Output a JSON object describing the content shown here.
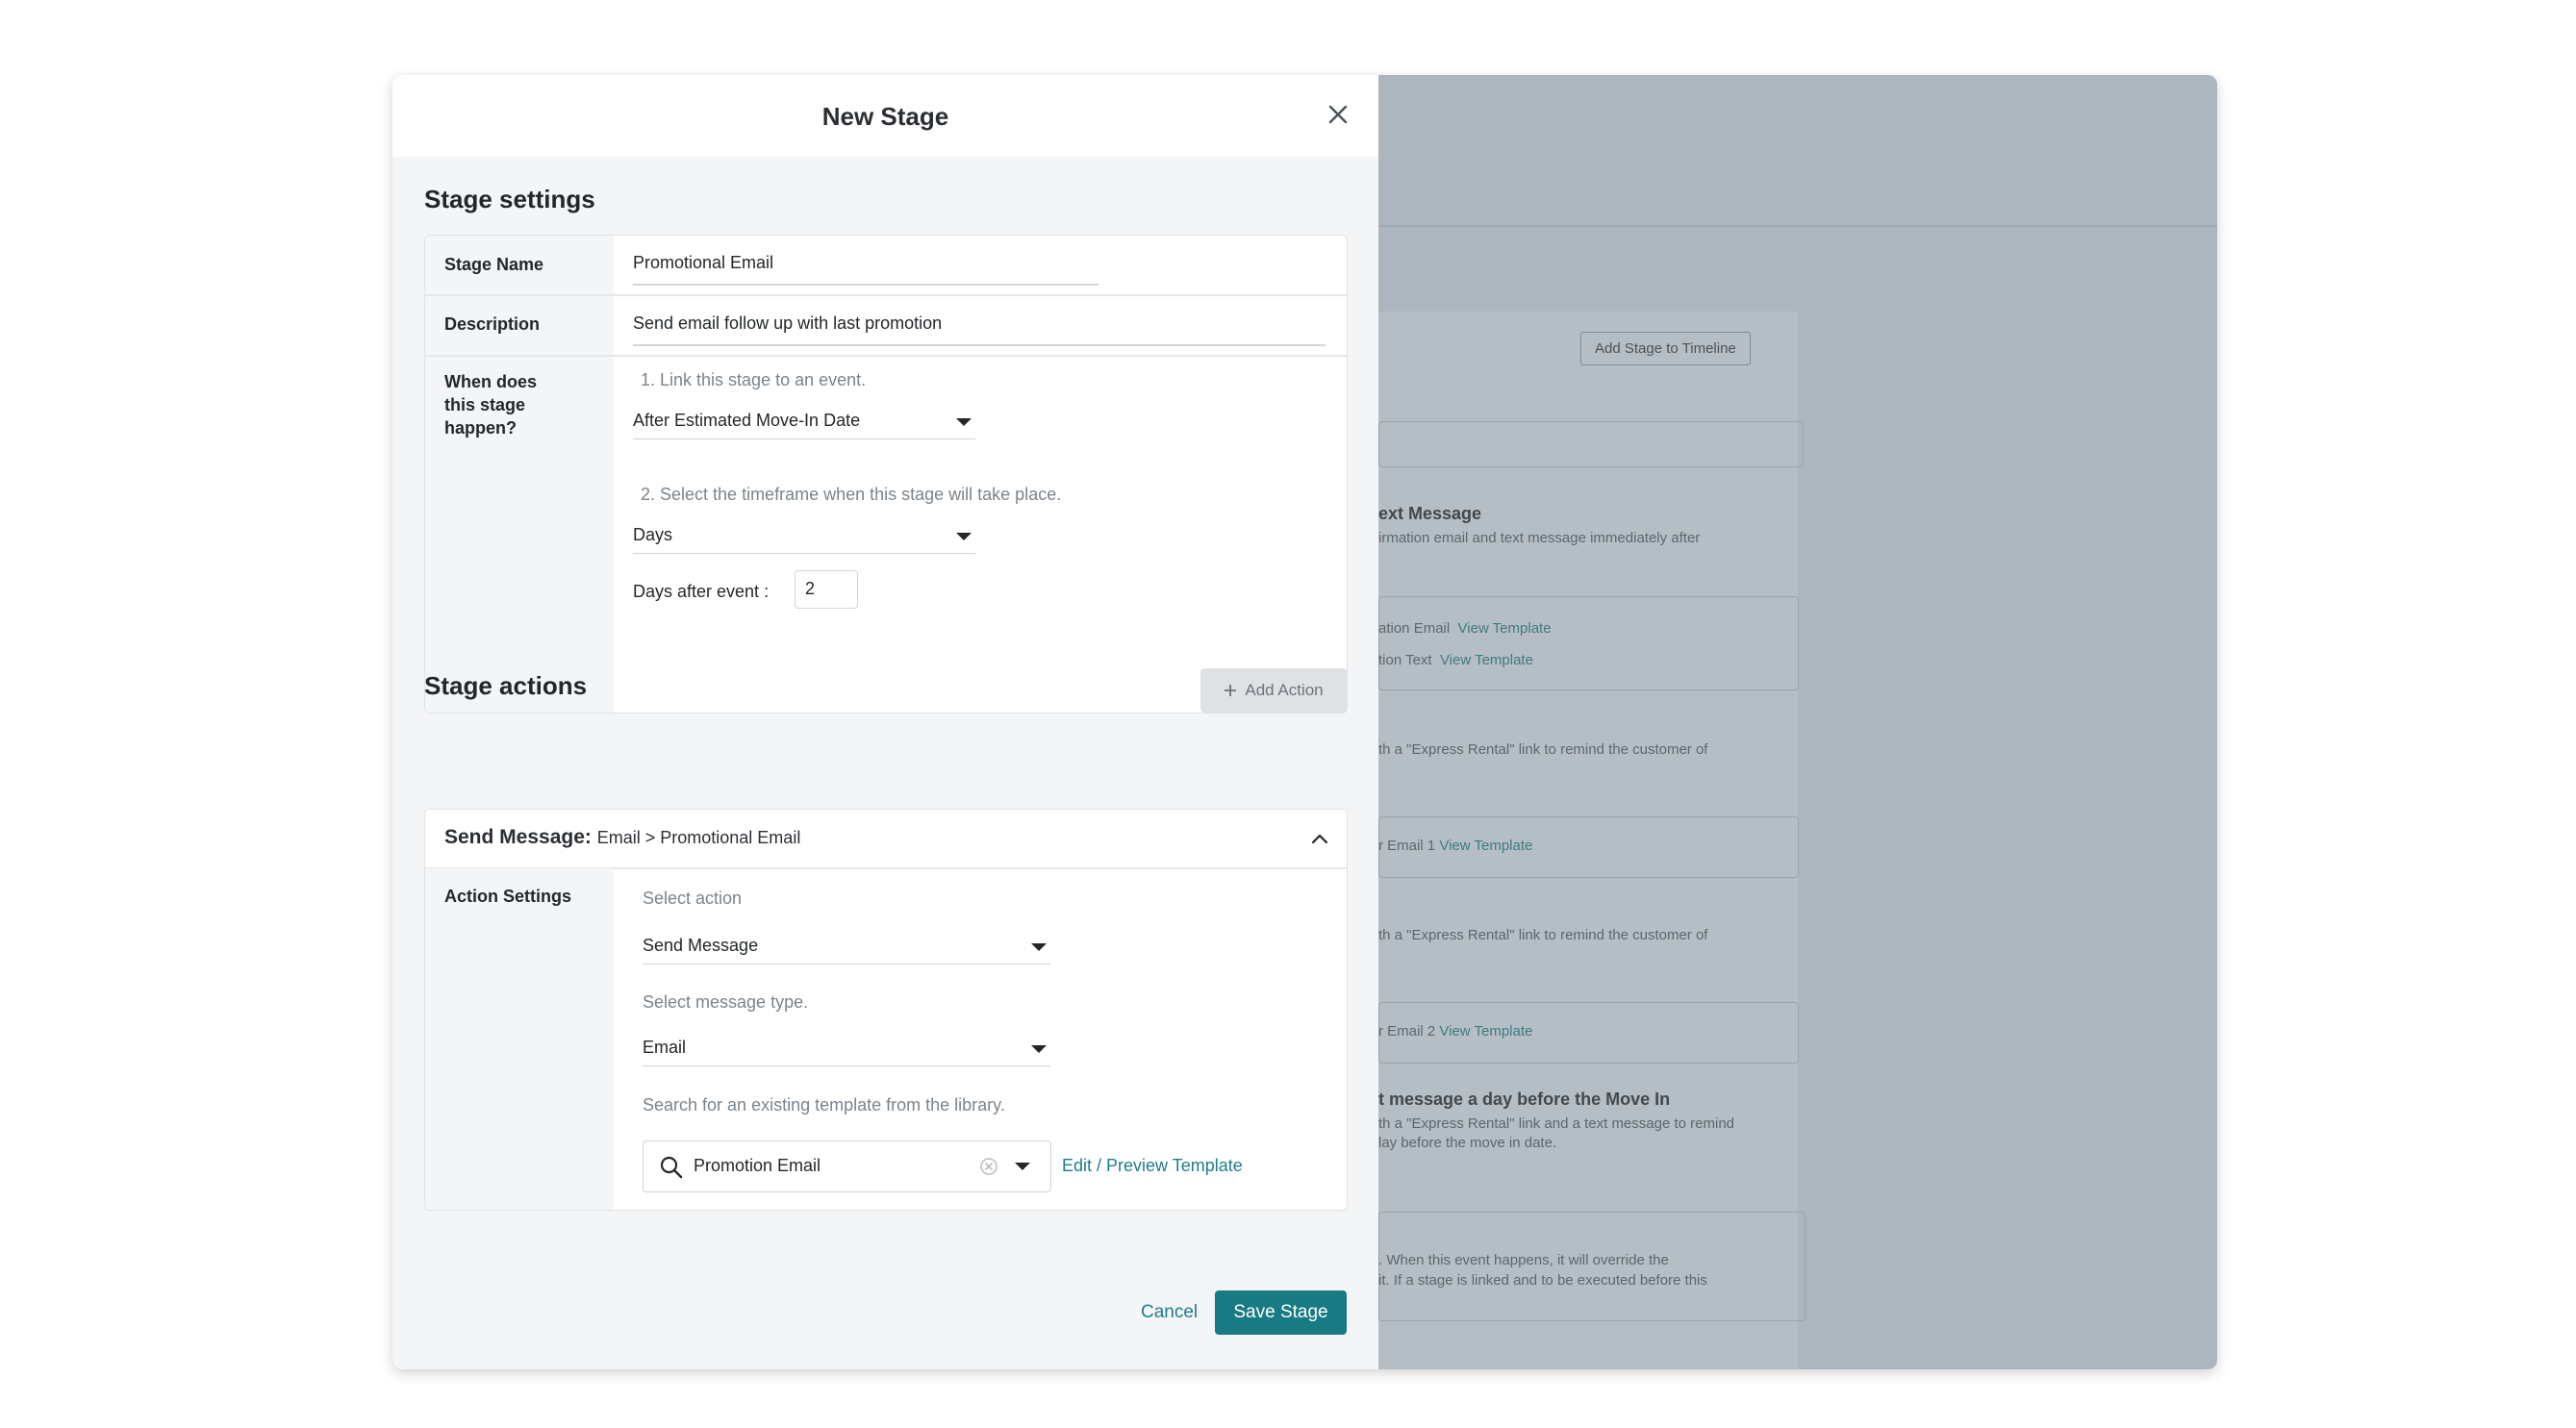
{
  "modal": {
    "title": "New Stage",
    "stage_settings": {
      "heading": "Stage settings",
      "stage_name_label": "Stage Name",
      "stage_name_value": "Promotional Email",
      "description_label": "Description",
      "description_value": "Send email follow up with last promotion",
      "when_label": "When does this stage happen?",
      "step1_hint": "1. Link this stage to an event.",
      "event_selected": "After Estimated Move-In Date",
      "step2_hint": "2. Select the timeframe when this stage will take place.",
      "timeframe_selected": "Days",
      "days_after_label": "Days after event :",
      "days_after_value": "2"
    },
    "stage_actions": {
      "heading": "Stage actions",
      "add_action_label": "Add Action",
      "action_title_bold": "Send Message:",
      "action_title_rest": "Email > Promotional Email",
      "action_settings_label": "Action Settings",
      "select_action_hint": "Select action",
      "action_selected": "Send Message",
      "message_type_hint": "Select message type.",
      "message_type_selected": "Email",
      "template_hint": "Search for an existing template from the  library.",
      "template_search_value": "Promotion Email",
      "edit_preview_link": "Edit / Preview Template"
    },
    "footer": {
      "cancel_label": "Cancel",
      "save_label": "Save Stage"
    }
  },
  "background": {
    "add_stage_button": "Add Stage to Timeline",
    "item1_title": "ext Message",
    "item1_desc": "irmation email and text message immediately after",
    "item1_email_label": "ation Email",
    "item1_text_label": "tion Text",
    "view_template": "View Template",
    "item2_desc": "th a \"Express Rental\" link to remind the customer of",
    "item2_email_label": "r Email 1",
    "item3_desc": "th a \"Express Rental\" link to remind the customer of",
    "item3_email_label": "r Email 2",
    "item4_title": "t message a day before the Move In",
    "item4_desc1": "th a \"Express Rental\" link and a text message to remind",
    "item4_desc2": "lay before the move in date.",
    "item5_desc1": ". When this event happens, it will override the",
    "item5_desc2": "it. If a stage is linked and to be executed before this"
  },
  "colors": {
    "accent": "#187a82",
    "link": "#1f7d86",
    "overlay": "#adb6be"
  }
}
